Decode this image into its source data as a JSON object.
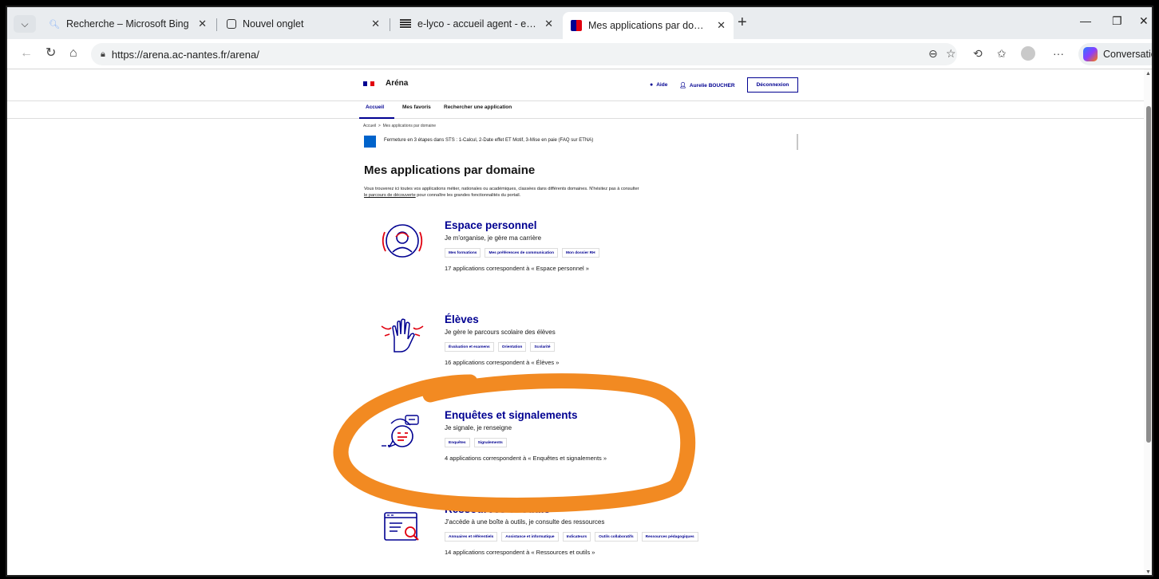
{
  "browser": {
    "tabs": [
      {
        "title": "Recherche – Microsoft Bing",
        "icon": "search-icon"
      },
      {
        "title": "Nouvel onglet",
        "icon": "new-tab-page-icon"
      },
      {
        "title": "e-lyco - accueil agent - e-lyco",
        "icon": "e-lyco-icon"
      },
      {
        "title": "Mes applications par domaine | Ar",
        "icon": "arena-icon",
        "active": true
      }
    ],
    "url": "https://arena.ac-nantes.fr/arena/",
    "copilot_label": "Conversation"
  },
  "site": {
    "brand": "Aréna",
    "help": "Aide",
    "user": "Aurelie BOUCHER",
    "logout": "Déconnexion",
    "nav": [
      "Accueil",
      "Mes favoris",
      "Rechercher une application"
    ],
    "breadcrumb": {
      "home": "Accueil",
      "sep": ">",
      "current": "Mes applications par domaine"
    },
    "notice": "Fermeture en 3 étapes dans STS : 1-Calcul, 2-Date effet ET Motif, 3-Mise en paie (FAQ sur ETNA)",
    "title": "Mes applications par domaine",
    "intro_a": "Vous trouverez ici toutes vos applications métier, nationales ou académiques, classées dans différents domaines. N'hésitez pas à consulter",
    "intro_link": "le parcours de découverte",
    "intro_b": "pour connaître les grandes fonctionnalités du portail."
  },
  "domains": [
    {
      "name": "Espace personnel",
      "desc": "Je m'organise, je gère ma carrière",
      "tags": [
        "Mes formations",
        "Mes préférences de communication",
        "Mon dossier RH"
      ],
      "count": "17 applications correspondent à « Espace personnel »",
      "icon": "profile-icon"
    },
    {
      "name": "Élèves",
      "desc": "Je gère le parcours scolaire des élèves",
      "tags": [
        "Évaluation et examens",
        "Orientation",
        "Scolarité"
      ],
      "count": "16 applications correspondent à « Élèves »",
      "icon": "hand-raised-icon"
    },
    {
      "name": "Enquêtes et signalements",
      "desc": "Je signale, je renseigne",
      "tags": [
        "Enquêtes",
        "Signalements"
      ],
      "count": "4 applications correspondent à « Enquêtes et signalements »",
      "icon": "chat-bubbles-icon"
    },
    {
      "name": "Ressources et outils",
      "desc": "J'accède à une boîte à outils, je consulte des ressources",
      "tags": [
        "Annuaires et référentiels",
        "Assistance et informatique",
        "Indicateurs",
        "Outils collaboratifs",
        "Ressources pédagogiques"
      ],
      "count": "14 applications correspondent à « Ressources et outils »",
      "icon": "document-search-icon"
    }
  ],
  "colors": {
    "primary": "#000091",
    "accent_red": "#e1000f",
    "annotation": "#f28a22"
  }
}
